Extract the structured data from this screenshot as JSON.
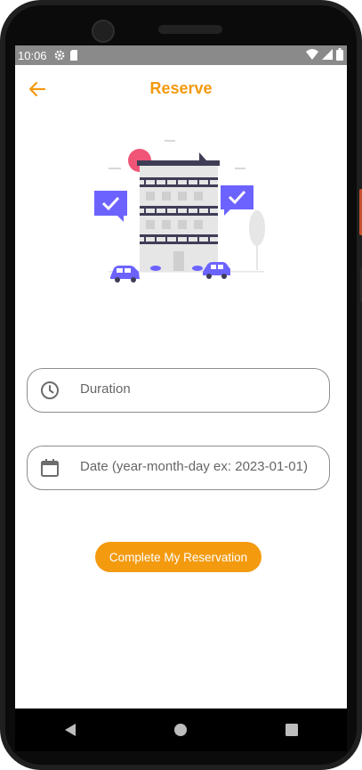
{
  "status_bar": {
    "time": "10:06"
  },
  "app_bar": {
    "title": "Reserve"
  },
  "form": {
    "duration_placeholder": "Duration",
    "date_placeholder": "Date (year-month-day ex: 2023-01-01)"
  },
  "actions": {
    "complete_label": "Complete My Reservation"
  },
  "colors": {
    "accent": "#f39a0f",
    "illustration_primary": "#6c63ff",
    "sun": "#f05477"
  },
  "icons": {
    "back": "arrow-left-icon",
    "duration": "clock-icon",
    "date": "calendar-icon",
    "settings": "gear-icon",
    "sim": "sim-card-icon",
    "wifi": "wifi-icon",
    "signal": "signal-icon",
    "battery": "battery-icon",
    "nav_back": "triangle-back-icon",
    "nav_home": "circle-home-icon",
    "nav_recents": "square-recents-icon"
  }
}
